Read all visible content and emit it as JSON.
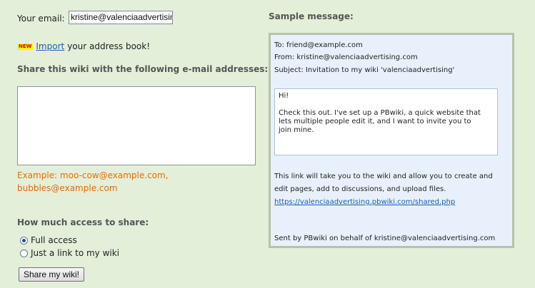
{
  "email": {
    "label": "Your email:",
    "value": "kristine@valenciaadvertising.com"
  },
  "import": {
    "badge": "NEW",
    "link_text": "Import",
    "suffix": "your address book!"
  },
  "share": {
    "heading": "Share this wiki with the following e-mail addresses:",
    "textarea_value": "",
    "example_line1": "Example: moo-cow@example.com,",
    "example_line2": "bubbles@example.com"
  },
  "access": {
    "heading": "How much access to share:",
    "options": [
      {
        "label": "Full access",
        "checked": true
      },
      {
        "label": "Just a link to my wiki",
        "checked": false
      }
    ]
  },
  "submit_label": "Share my wiki!",
  "sample": {
    "heading": "Sample message:",
    "to": "To: friend@example.com",
    "from": "From: kristine@valenciaadvertising.com",
    "subject": "Subject: Invitation to my wiki 'valenciaadvertising'",
    "greeting": "Hi!",
    "body_line1": "Check this out. I've set up a PBwiki, a quick website that",
    "body_line2": "lets multiple people edit it, and I want to invite you to",
    "body_line3": "join mine.",
    "info_line1": "This link will take you to the wiki and allow you to create and",
    "info_line2": "edit pages, add to discussions, and upload files.",
    "link": "https://valenciaadvertising.pbwiki.com/shared.php",
    "footer": "Sent by PBwiki on behalf of kristine@valenciaadvertising.com"
  },
  "colors": {
    "page_bg": "#e3efd9",
    "example_text": "#e36c0a",
    "link": "#1a5fb4",
    "sample_bg": "#e8f1fb"
  }
}
